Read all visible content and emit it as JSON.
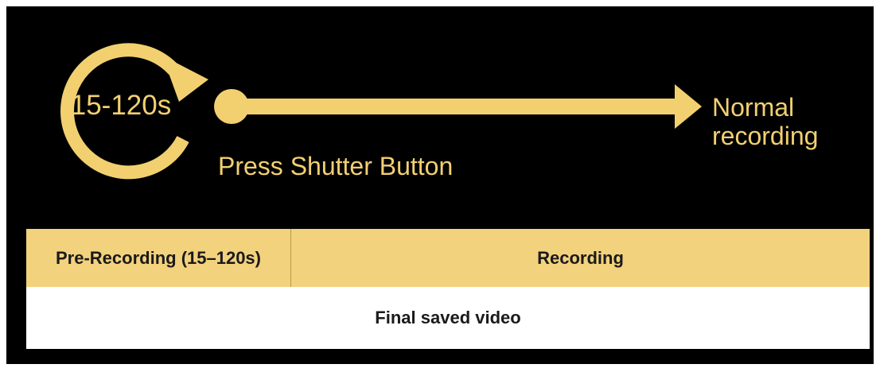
{
  "colors": {
    "background": "#000000",
    "accent": "#f2d070",
    "timeline_fill": "#f3d27d",
    "final_fill": "#ffffff"
  },
  "diagram": {
    "cycle_label": "15-120s",
    "trigger_label": "Press Shutter Button",
    "result_label": "Normal recording"
  },
  "timeline": {
    "pre_recording": "Pre-Recording (15–120s)",
    "recording": "Recording",
    "final": "Final saved video"
  }
}
